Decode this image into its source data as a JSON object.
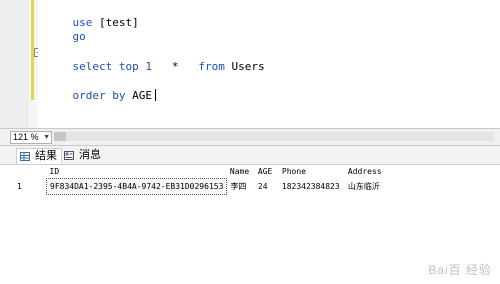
{
  "editor": {
    "lines": [
      {
        "kw": "use",
        "rest": " [test]"
      },
      {
        "kw": "go",
        "rest": ""
      },
      {
        "kw": "",
        "rest": ""
      },
      {
        "kw": "select top 1",
        "rest": "   *   ",
        "kw2": "from",
        "rest2": " Users"
      },
      {
        "kw": "",
        "rest": ""
      },
      {
        "kw": "order by",
        "rest": " AGE"
      }
    ]
  },
  "status": {
    "zoom": "121 %"
  },
  "tabs": [
    {
      "label": "结果",
      "icon": "grid-icon"
    },
    {
      "label": "消息",
      "icon": "message-icon"
    }
  ],
  "results": {
    "columns": [
      "ID",
      "Name",
      "AGE",
      "Phone",
      "Address"
    ],
    "rows": [
      {
        "num": "1",
        "ID": "9F834DA1-2395-4B4A-9742-EB31D0296153",
        "Name": "李四",
        "AGE": "24",
        "Phone": "182342384823",
        "Address": "山东临沂"
      }
    ]
  },
  "watermark": "Bai百 经验"
}
